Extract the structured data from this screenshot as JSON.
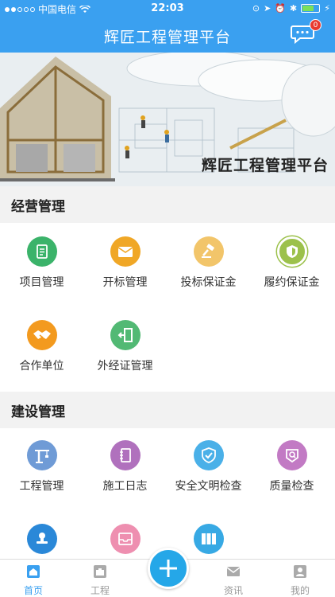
{
  "status_bar": {
    "carrier": "中国电信",
    "time": "22:03"
  },
  "nav": {
    "title": "辉匠工程管理平台",
    "message_badge": "0"
  },
  "banner": {
    "text": "辉匠工程管理平台"
  },
  "sections": [
    {
      "title": "经营管理",
      "items": [
        {
          "label": "项目管理",
          "icon": "clipboard-icon",
          "color": "#3bb36a"
        },
        {
          "label": "开标管理",
          "icon": "envelope-icon",
          "color": "#f0a726"
        },
        {
          "label": "投标保证金",
          "icon": "gavel-icon",
          "color": "#f2c56a"
        },
        {
          "label": "履约保证金",
          "icon": "shield-icon",
          "color": "#9cc14b"
        },
        {
          "label": "合作单位",
          "icon": "handshake-icon",
          "color": "#f39a1f"
        },
        {
          "label": "外经证管理",
          "icon": "exit-door-icon",
          "color": "#52b974"
        }
      ]
    },
    {
      "title": "建设管理",
      "items": [
        {
          "label": "工程管理",
          "icon": "crane-icon",
          "color": "#6f9bd6"
        },
        {
          "label": "施工日志",
          "icon": "notebook-icon",
          "color": "#b071bd"
        },
        {
          "label": "安全文明检查",
          "icon": "safety-shield-icon",
          "color": "#4ab0e8"
        },
        {
          "label": "质量检查",
          "icon": "quality-badge-icon",
          "color": "#c27ac4"
        },
        {
          "label": "",
          "icon": "stamp-icon",
          "color": "#2a88d8"
        },
        {
          "label": "",
          "icon": "inbox-icon",
          "color": "#ee8fb0"
        },
        {
          "label": "",
          "icon": "binders-icon",
          "color": "#37a9e4"
        }
      ]
    }
  ],
  "tabs": [
    {
      "label": "首页",
      "icon": "home-icon",
      "active": true
    },
    {
      "label": "工程",
      "icon": "briefcase-icon",
      "active": false
    },
    {
      "label": "资讯",
      "icon": "mail-icon",
      "active": false
    },
    {
      "label": "我的",
      "icon": "user-icon",
      "active": false
    }
  ],
  "fab": {
    "icon": "plus-icon"
  },
  "colors": {
    "primary": "#3aa0f0",
    "fab": "#25a7e8",
    "badge": "#e83a30"
  }
}
